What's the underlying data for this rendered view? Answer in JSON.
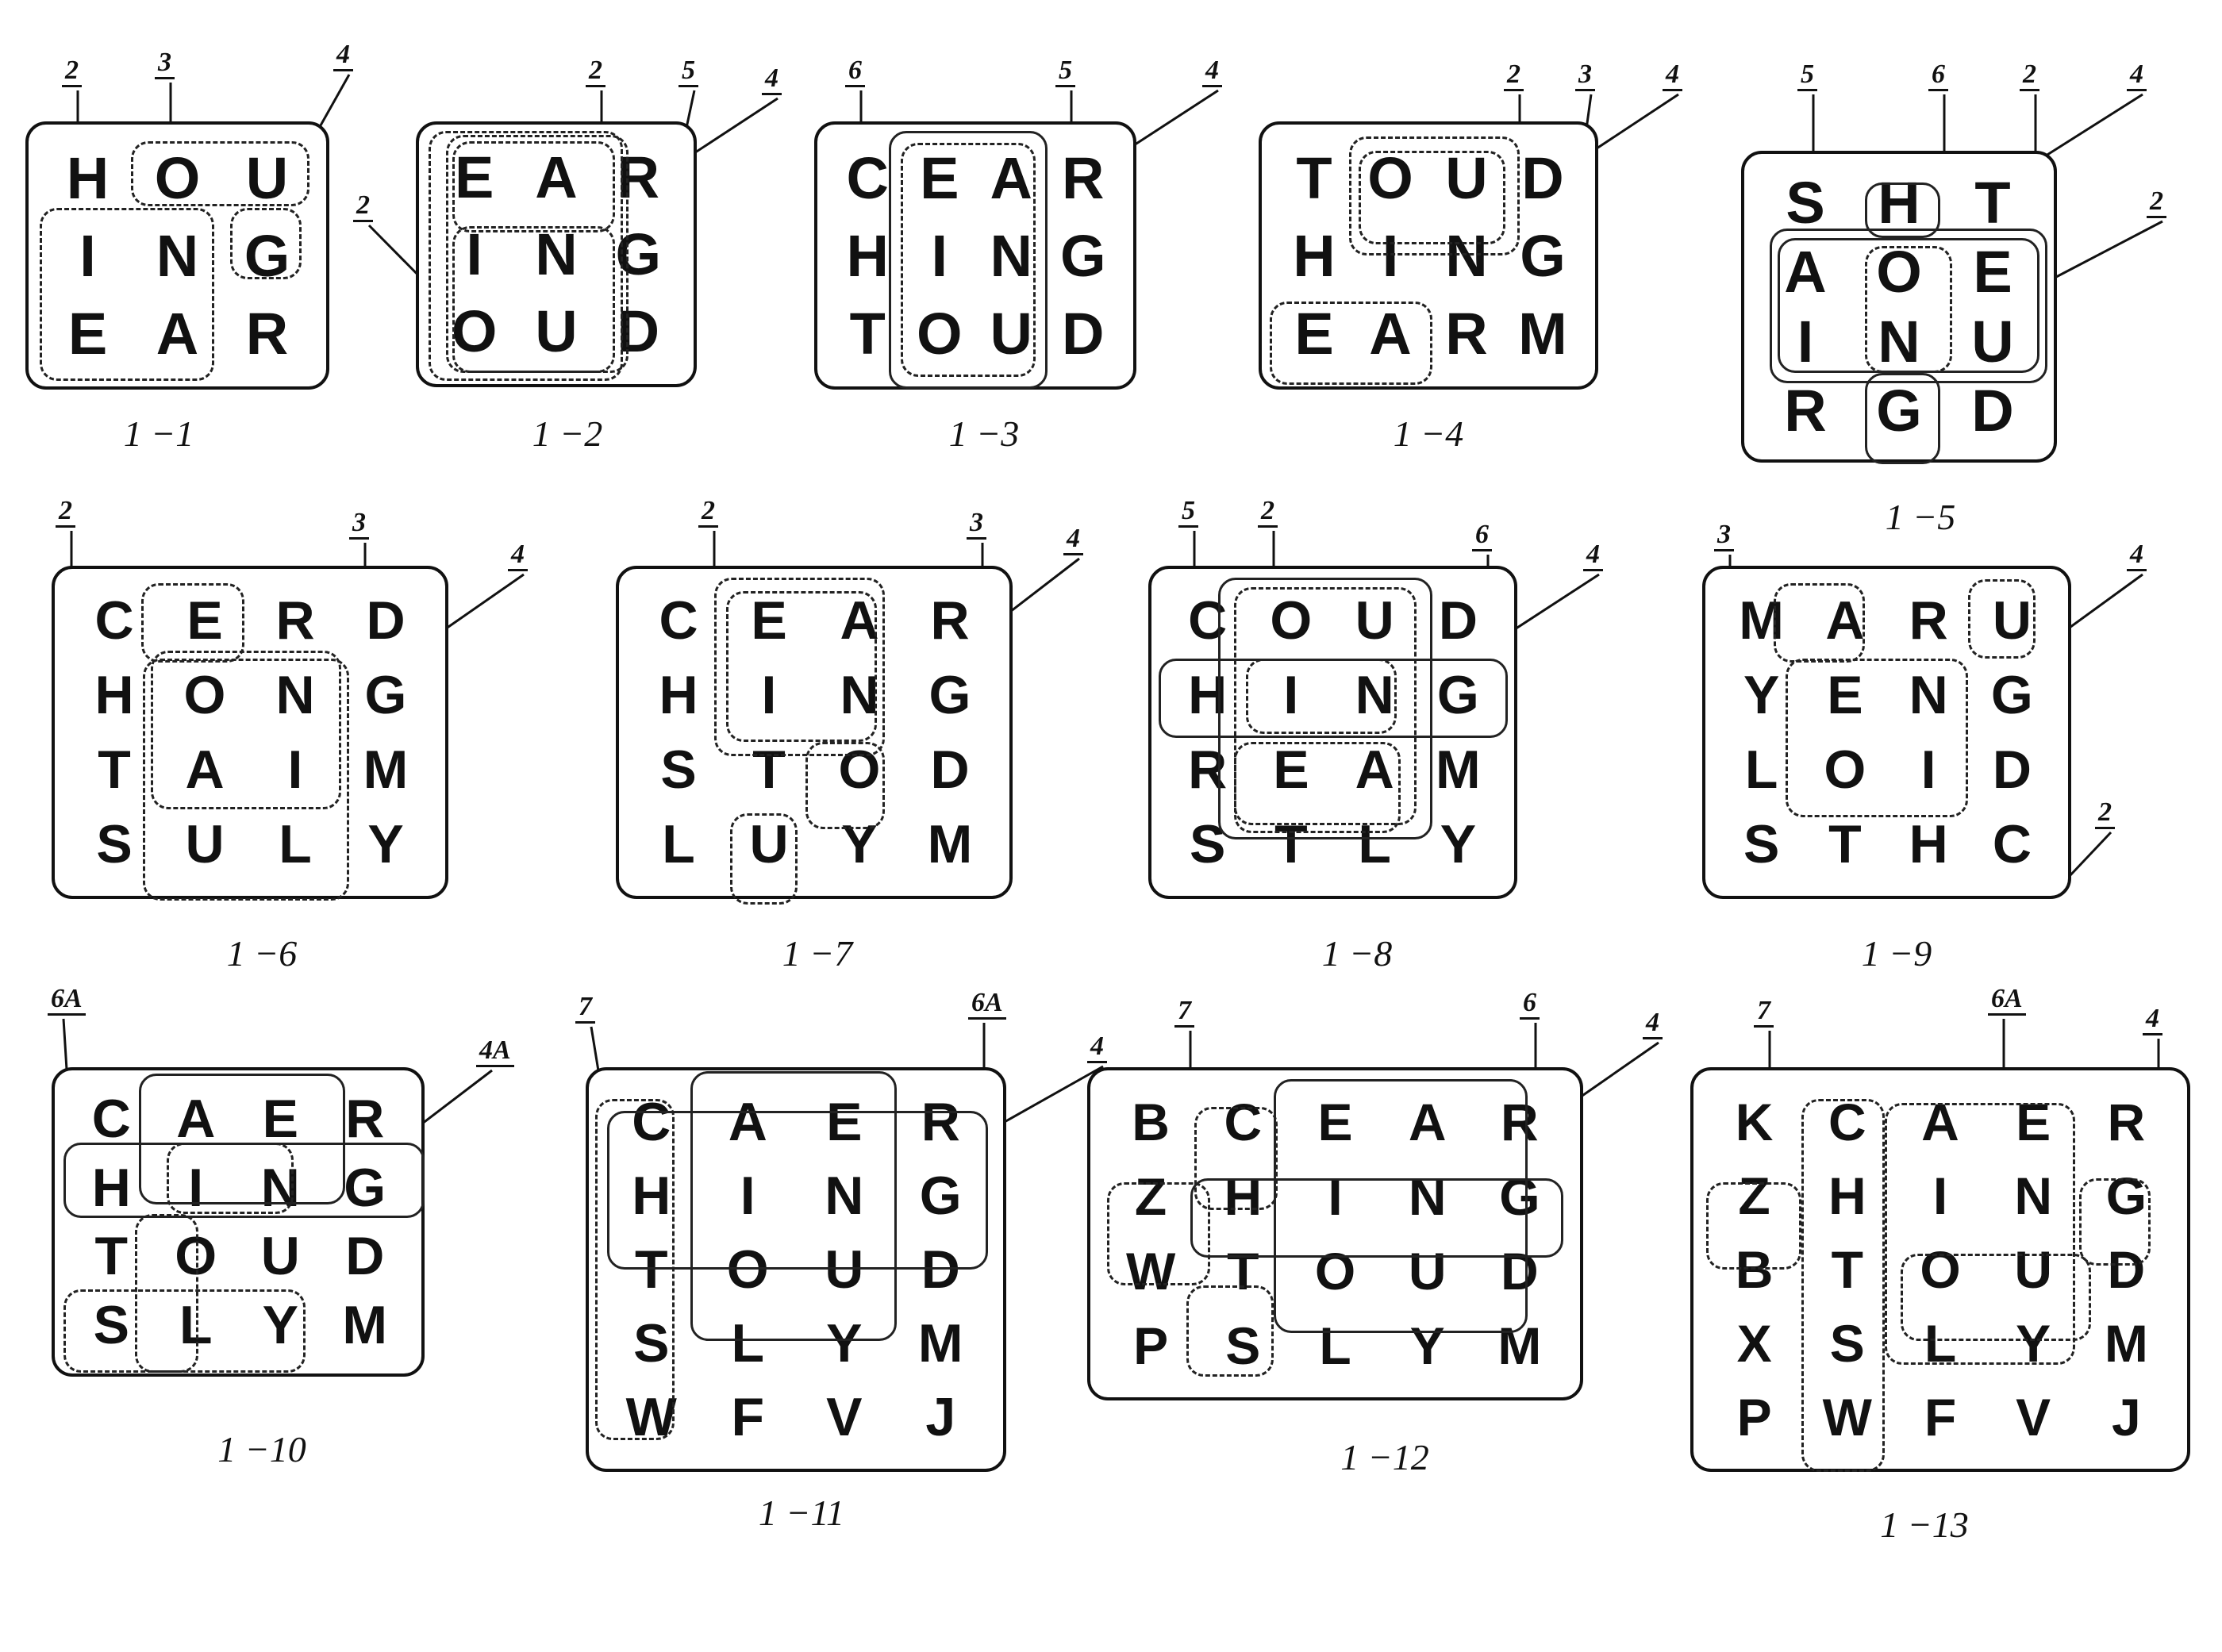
{
  "figures": [
    {
      "id": "1-1",
      "caption": "1 −1",
      "rows": [
        "HOU",
        "ING",
        "EAR"
      ],
      "refs": [
        "2",
        "3",
        "4"
      ]
    },
    {
      "id": "1-2",
      "caption": "1 −2",
      "rows": [
        "EAR",
        "ING",
        "OUD"
      ],
      "refs": [
        "2",
        "5",
        "4",
        "2"
      ]
    },
    {
      "id": "1-3",
      "caption": "1 −3",
      "rows": [
        "CEAR",
        "HING",
        "TOUD"
      ],
      "refs": [
        "6",
        "5",
        "4"
      ]
    },
    {
      "id": "1-4",
      "caption": "1 −4",
      "rows": [
        "TOUD",
        "HING",
        "EARM"
      ],
      "refs": [
        "2",
        "3",
        "4"
      ]
    },
    {
      "id": "1-5",
      "caption": "1 −5",
      "rows": [
        "SHT",
        "AOE",
        "INU",
        "RGD"
      ],
      "refs": [
        "5",
        "6",
        "2",
        "4",
        "2"
      ]
    },
    {
      "id": "1-6",
      "caption": "1 −6",
      "rows": [
        "CERD",
        "HONG",
        "TAIM",
        "SULY"
      ],
      "refs": [
        "2",
        "3",
        "4"
      ]
    },
    {
      "id": "1-7",
      "caption": "1 −7",
      "rows": [
        "CEAR",
        "HING",
        "STOD",
        "LUYM"
      ],
      "refs": [
        "2",
        "3",
        "4"
      ]
    },
    {
      "id": "1-8",
      "caption": "1 −8",
      "rows": [
        "COUD",
        "HING",
        "REAM",
        "STLY"
      ],
      "refs": [
        "5",
        "2",
        "6",
        "4"
      ]
    },
    {
      "id": "1-9",
      "caption": "1 −9",
      "rows": [
        "MARU",
        "YENG",
        "LOID",
        "STHC"
      ],
      "refs": [
        "3",
        "4",
        "2"
      ]
    },
    {
      "id": "1-10",
      "caption": "1 −10",
      "rows": [
        "CAER",
        "HING",
        "TOUD",
        "SLYM"
      ],
      "refs": [
        "6A",
        "4A"
      ]
    },
    {
      "id": "1-11",
      "caption": "1 −11",
      "rows": [
        "CAER",
        "HING",
        "TOUD",
        "SLYM",
        "WFVJ"
      ],
      "refs": [
        "7",
        "6A",
        "4"
      ]
    },
    {
      "id": "1-12",
      "caption": "1 −12",
      "rows": [
        "BCEAR",
        "ZHING",
        "WTOUD",
        "PSLYM"
      ],
      "refs": [
        "7",
        "6",
        "4"
      ]
    },
    {
      "id": "1-13",
      "caption": "1 −13",
      "rows": [
        "KCAER",
        "ZHING",
        "BTOUD",
        "XSLYM",
        "PWFVJ"
      ],
      "refs": [
        "7",
        "6A",
        "4"
      ]
    }
  ]
}
